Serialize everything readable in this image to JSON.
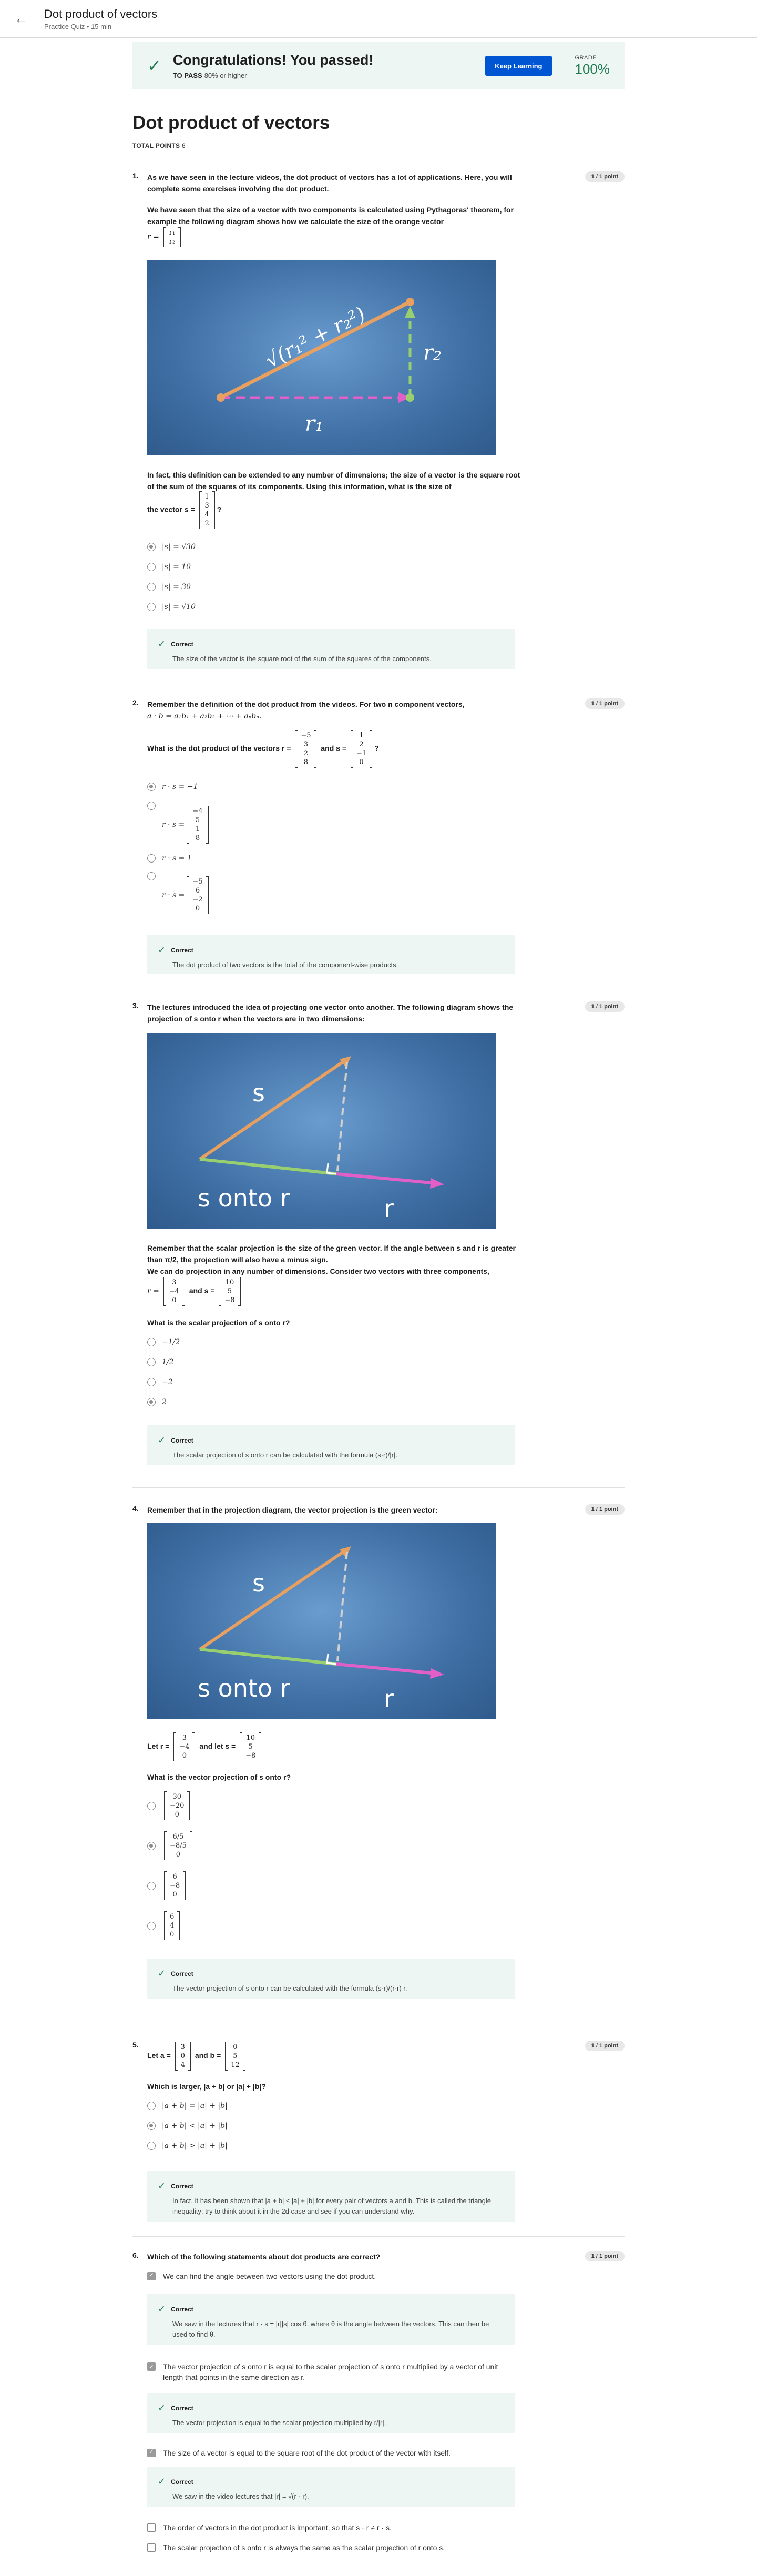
{
  "header": {
    "title": "Dot product of vectors",
    "meta": "Practice Quiz • 15 min"
  },
  "banner": {
    "message": "Congratulations! You passed!",
    "to_pass_label": "TO PASS",
    "to_pass_value": "80% or higher",
    "keep_learning": "Keep Learning",
    "grade_label": "GRADE",
    "grade_value": "100%"
  },
  "quiz": {
    "title": "Dot product of vectors",
    "total_points_label": "TOTAL POINTS",
    "total_points_value": "6"
  },
  "points_badge": "1 / 1 point",
  "feedback_label": "Correct",
  "q1": {
    "num": "1.",
    "p1": "As we have seen in the lecture videos, the dot product of vectors has a lot of applications. Here, you will complete some exercises involving the dot product.",
    "p2": "We have seen that the size of a vector with two components is calculated using Pythagoras' theorem, for example the following diagram shows how we calculate the size of the orange vector",
    "r_label": "r =",
    "r_vec": [
      "r₁",
      "r₂"
    ],
    "fig_sqrt": "√(r₁² + r₂²)",
    "fig_r1": "r₁",
    "fig_r2": "r₂",
    "p3": "In fact, this definition can be extended to any number of dimensions; the size of a vector is the square root of the sum of the squares of its components. Using this information, what is the size of",
    "p3b": "the vector s =",
    "s_vec": [
      "1",
      "3",
      "4",
      "2"
    ],
    "options": [
      "|s| = √30",
      "|s| = 10",
      "|s| = 30",
      "|s| = √10"
    ],
    "selected": 0,
    "feedback": "The size of the vector is the square root of the sum of the squares of the components."
  },
  "q2": {
    "num": "2.",
    "p1": "Remember the definition of the dot product from the videos. For two n component vectors,",
    "p1b": "a · b = a₁b₁ + a₂b₂ + ⋯ + aₙbₙ.",
    "p2a": "What is the dot product of the vectors r =",
    "r_vec": [
      "−5",
      "3",
      "2",
      "8"
    ],
    "p2b": "and s =",
    "s_vec": [
      "1",
      "2",
      "−1",
      "0"
    ],
    "opt1": "r · s = −1",
    "opt2_label": "r · s =",
    "opt2_vec": [
      "−4",
      "5",
      "1",
      "8"
    ],
    "opt3": "r · s = 1",
    "opt4_label": "r · s =",
    "opt4_vec": [
      "−5",
      "6",
      "−2",
      "0"
    ],
    "selected": 0,
    "feedback": "The dot product of two vectors is the total of the component-wise products."
  },
  "q3": {
    "num": "3.",
    "p1": "The lectures introduced the idea of projecting one vector onto another. The following diagram shows the projection of s onto r when the vectors are in two dimensions:",
    "fig_s": "s",
    "fig_onto": "s onto r",
    "fig_r": "r",
    "p2": "Remember that the scalar projection is the size of the green vector. If the angle between s and r is greater than π/2, the projection will also have a minus sign.",
    "p3": "We can do projection in any number of dimensions. Consider two vectors with three components,",
    "r_label": "r =",
    "r_vec": [
      "3",
      "−4",
      "0"
    ],
    "s_label": "and s =",
    "s_vec": [
      "10",
      "5",
      "−8"
    ],
    "question": "What is the scalar projection of s onto r?",
    "options": [
      "−1/2",
      "1/2",
      "−2",
      "2"
    ],
    "selected": 3,
    "feedback": "The scalar projection of s onto r can be calculated with the formula (s·r)/|r|."
  },
  "q4": {
    "num": "4.",
    "p1": "Remember that in the projection diagram, the vector projection is the green vector:",
    "fig_s": "s",
    "fig_onto": "s onto r",
    "fig_r": "r",
    "let_r": "Let r =",
    "r_vec": [
      "3",
      "−4",
      "0"
    ],
    "let_s": "and let s =",
    "s_vec": [
      "10",
      "5",
      "−8"
    ],
    "question": "What is the vector projection of s onto r?",
    "options": [
      [
        "30",
        "−20",
        "0"
      ],
      [
        "6/5",
        "−8/5",
        "0"
      ],
      [
        "6",
        "−8",
        "0"
      ],
      [
        "6",
        "4",
        "0"
      ]
    ],
    "selected": 1,
    "feedback": "The vector projection of s onto r can be calculated with the formula (s·r)/(r·r) r."
  },
  "q5": {
    "num": "5.",
    "let_a": "Let a =",
    "a_vec": [
      "3",
      "0",
      "4"
    ],
    "and_b": "and b =",
    "b_vec": [
      "0",
      "5",
      "12"
    ],
    "question": "Which is larger, |a + b| or |a| + |b|?",
    "options": [
      "|a + b| = |a| + |b|",
      "|a + b| < |a| + |b|",
      "|a + b| > |a| + |b|"
    ],
    "selected": 1,
    "feedback": "In fact, it has been shown that |a + b| ≤ |a| + |b| for every pair of vectors a and b. This is called the triangle inequality; try to think about it in the 2d case and see if you can understand why."
  },
  "q6": {
    "num": "6.",
    "question": "Which of the following statements about dot products are correct?",
    "items": [
      {
        "text": "We can find the angle between two vectors using the dot product.",
        "checked": true,
        "feedback": "We saw in the lectures that r · s = |r||s| cos θ, where θ is the angle between the vectors. This can then be used to find θ."
      },
      {
        "text": "The vector projection of s onto r is equal to the scalar projection of s onto r multiplied by a vector of unit length that points in the same direction as r.",
        "checked": true,
        "feedback": "The vector projection is equal to the scalar projection multiplied by r/|r|."
      },
      {
        "text": "The size of a vector is equal to the square root of the dot product of the vector with itself.",
        "checked": true,
        "feedback": "We saw in the video lectures that |r| = √(r · r)."
      },
      {
        "text": "The order of vectors in the dot product is important, so that s · r ≠ r · s.",
        "checked": false
      },
      {
        "text": "The scalar projection of s onto r is always the same as the scalar projection of r onto s.",
        "checked": false
      }
    ]
  }
}
